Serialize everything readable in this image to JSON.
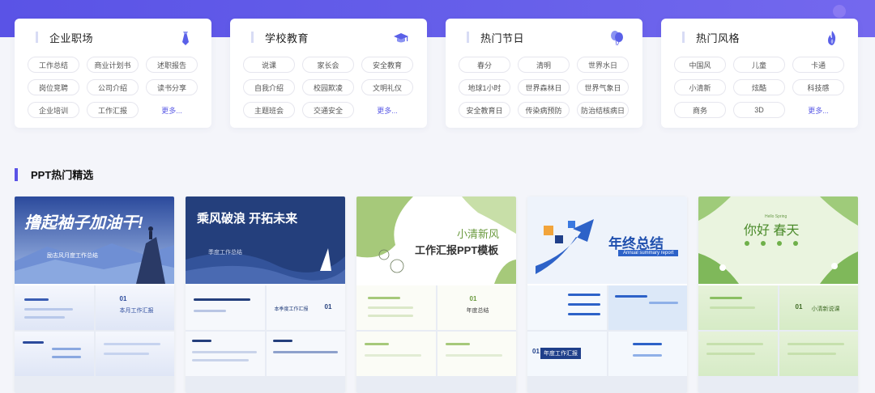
{
  "categories": [
    {
      "title": "企业职场",
      "icon": "necktie-icon",
      "tags": [
        "工作总结",
        "商业计划书",
        "述职报告",
        "岗位竞聘",
        "公司介绍",
        "读书分享",
        "企业培训",
        "工作汇报",
        "更多..."
      ]
    },
    {
      "title": "学校教育",
      "icon": "graduation-cap-icon",
      "tags": [
        "说课",
        "家长会",
        "安全教育",
        "自我介绍",
        "校园欺凌",
        "文明礼仪",
        "主题班会",
        "交通安全",
        "更多..."
      ]
    },
    {
      "title": "热门节日",
      "icon": "balloons-icon",
      "tags": [
        "春分",
        "清明",
        "世界水日",
        "地球1小时",
        "世界森林日",
        "世界气象日",
        "安全教育日",
        "传染病预防",
        "防治结核病日"
      ]
    },
    {
      "title": "热门风格",
      "icon": "flame-icon",
      "tags": [
        "中国风",
        "儿童",
        "卡通",
        "小清新",
        "炫酷",
        "科技感",
        "商务",
        "3D",
        "更多..."
      ]
    }
  ],
  "section": {
    "title": "PPT热门精选"
  },
  "thumbs": [
    {
      "heading": "撸起袖子加油干!",
      "sub": "励志风月度工作总结",
      "slide_title": "本月工作汇报",
      "slide_num": "01"
    },
    {
      "heading": "乘风破浪 开拓未来",
      "sub": "季度工作总结",
      "slide_title": "本季度工作汇报",
      "slide_num": "01"
    },
    {
      "heading": "小清新风",
      "sub": "工作汇报PPT模板",
      "slide_title": "年度总结",
      "slide_num": "01"
    },
    {
      "heading": "年终总结",
      "sub": "Annual summary report",
      "slide_title": "年度工作汇报",
      "slide_num": "01"
    },
    {
      "heading": "你好 春天",
      "sub": "Hello Spring",
      "slide_title": "小清新说课",
      "slide_num": "01"
    }
  ]
}
